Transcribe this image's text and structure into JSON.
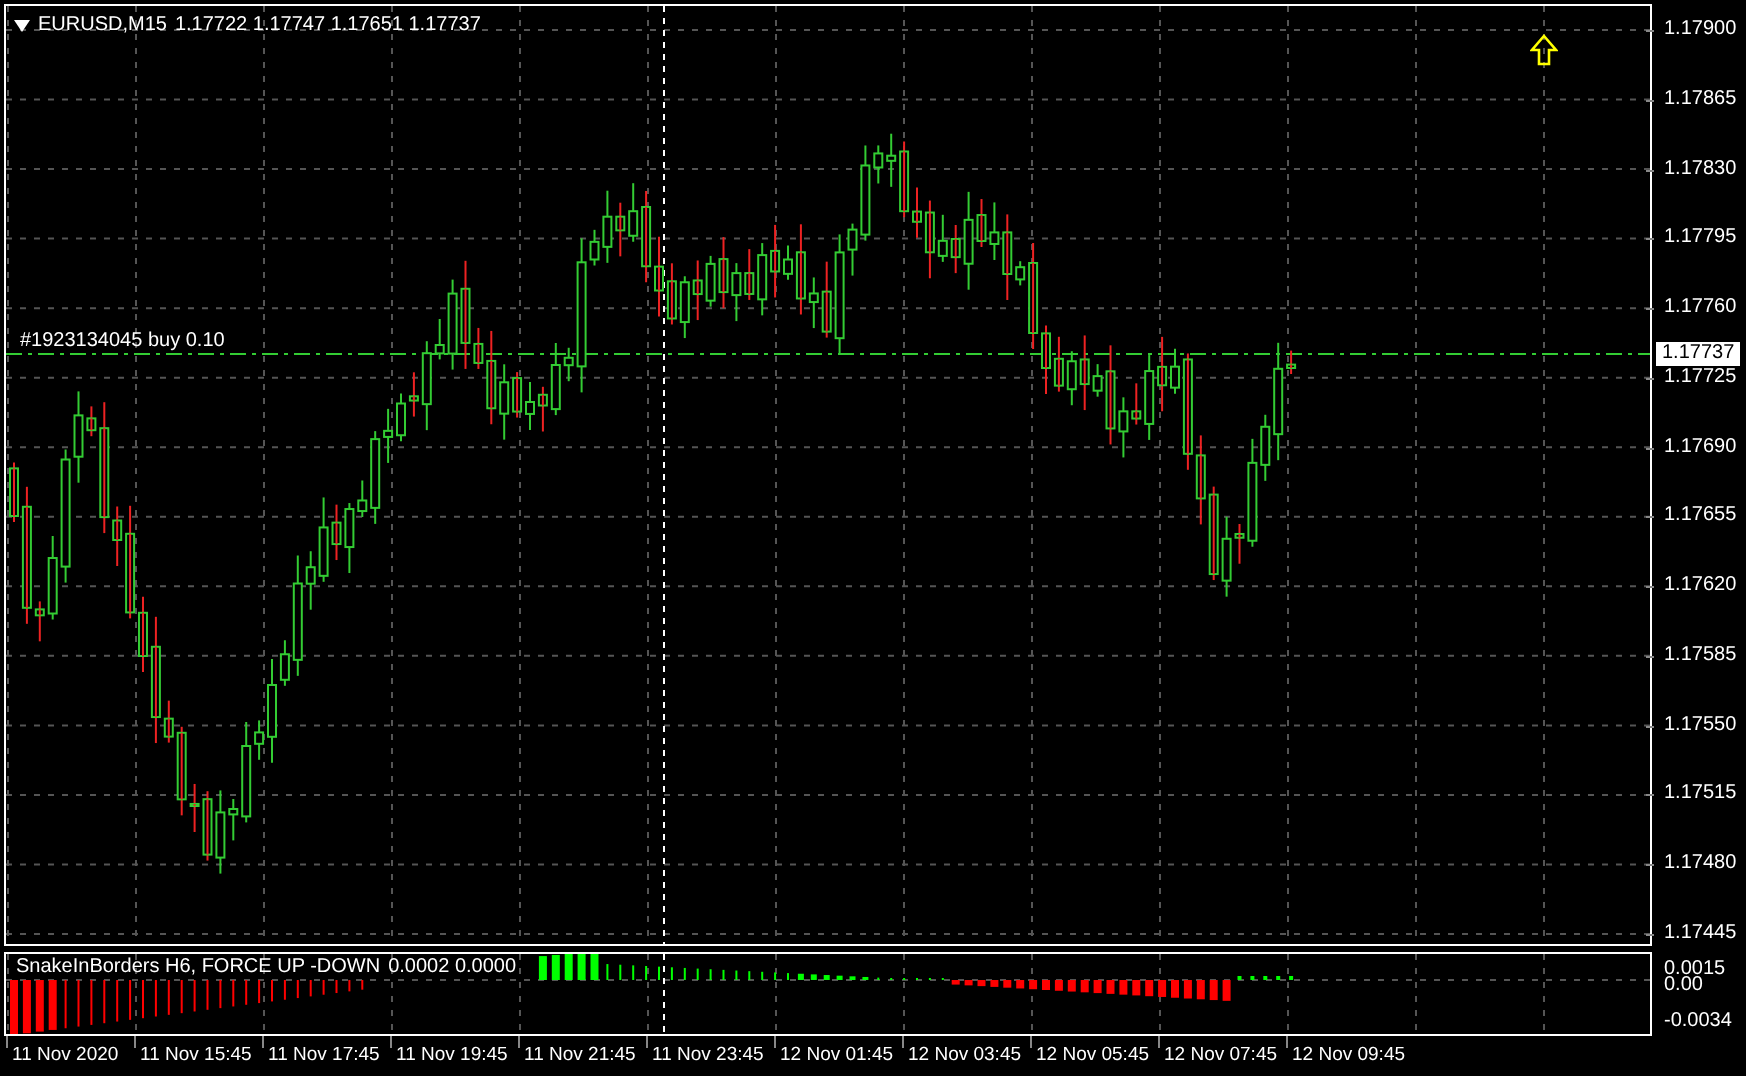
{
  "chart": {
    "title": {
      "symbol": "EURUSD,M15",
      "ohlc": "1.17722 1.17747 1.17651 1.17737"
    },
    "order_label": "#1923134045 buy 0.10",
    "price_axis": [
      "1.17900",
      "1.17865",
      "1.17830",
      "1.17795",
      "1.17760",
      "1.17725",
      "1.17690",
      "1.17655",
      "1.17620",
      "1.17585",
      "1.17550",
      "1.17515",
      "1.17480",
      "1.17445"
    ],
    "current_price": "1.17737"
  },
  "indicator": {
    "label": "SnakeInBorders H6, FORCE UP -DOWN",
    "values": "0.0002 0.0000",
    "axis": [
      "0.0015",
      "0.00",
      "-0.0034"
    ]
  },
  "time_axis": [
    "11 Nov 2020",
    "11 Nov 15:45",
    "11 Nov 17:45",
    "11 Nov 19:45",
    "11 Nov 21:45",
    "11 Nov 23:45",
    "12 Nov 01:45",
    "12 Nov 03:45",
    "12 Nov 05:45",
    "12 Nov 07:45",
    "12 Nov 09:45"
  ]
}
